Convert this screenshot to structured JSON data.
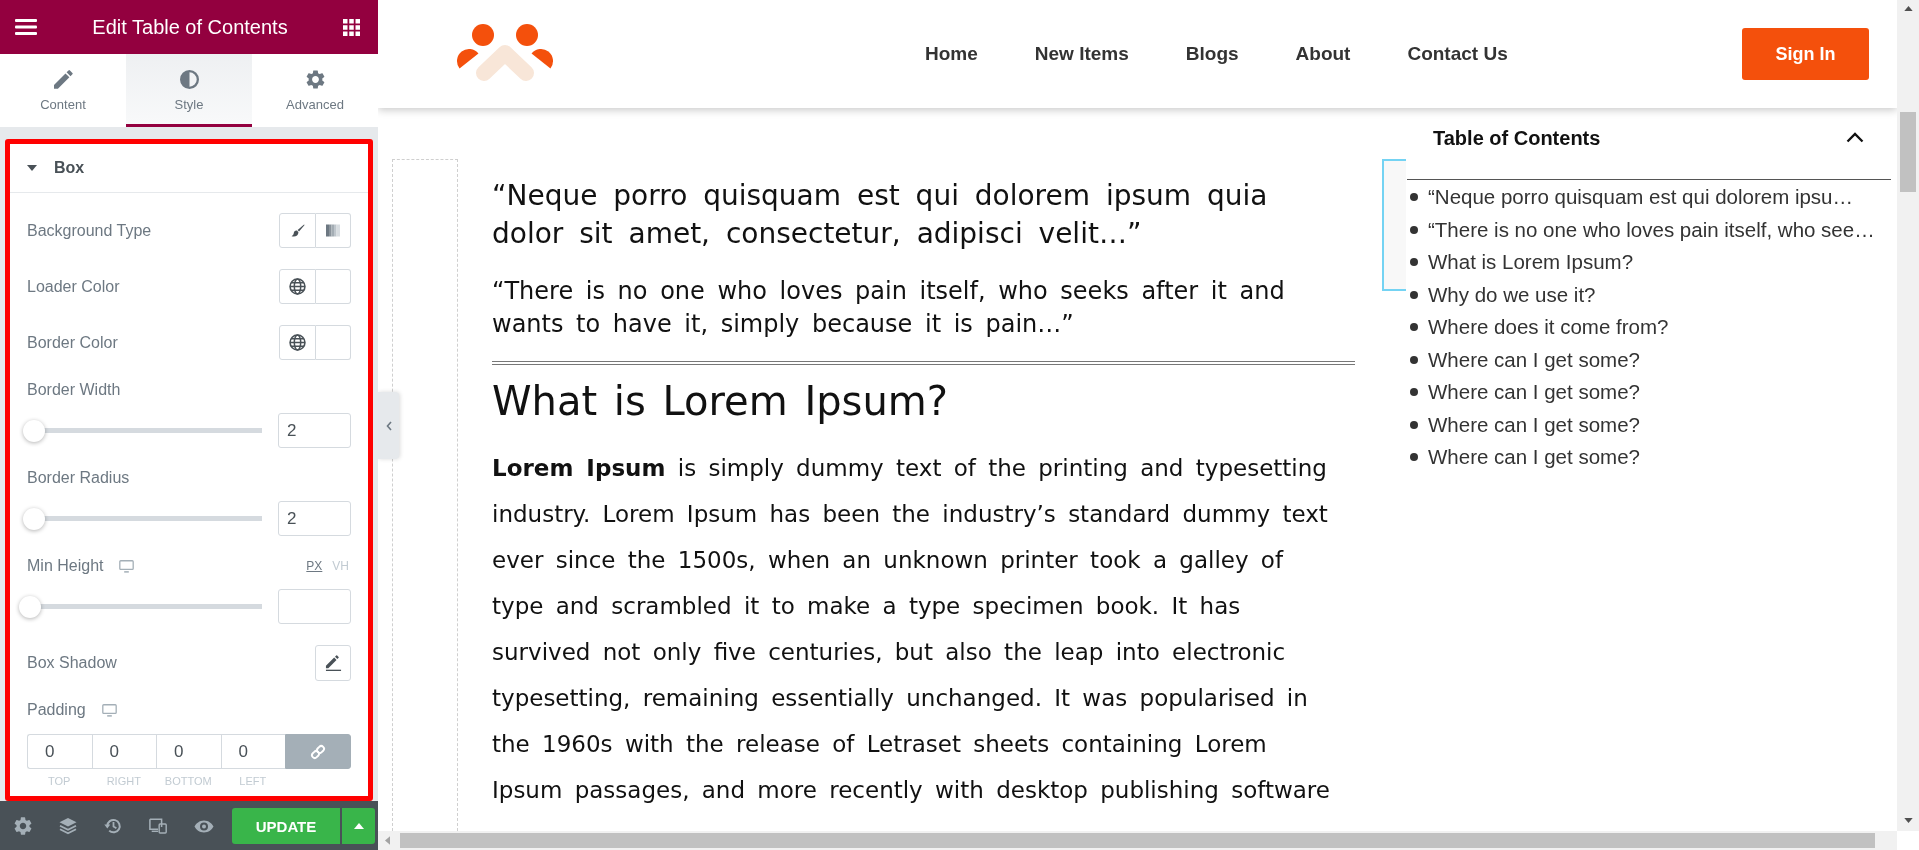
{
  "editor": {
    "title": "Edit Table of Contents",
    "tabs": [
      {
        "label": "Content",
        "selected": false
      },
      {
        "label": "Style",
        "selected": true
      },
      {
        "label": "Advanced",
        "selected": false
      }
    ],
    "section": {
      "title": "Box",
      "expanded": true,
      "controls": [
        {
          "kind": "choose",
          "label": "Background Type"
        },
        {
          "kind": "color",
          "label": "Loader Color"
        },
        {
          "kind": "color",
          "label": "Border Color"
        },
        {
          "kind": "slider",
          "label": "Border Width",
          "level": 0.02,
          "value": "2"
        },
        {
          "kind": "slider",
          "label": "Border Radius",
          "level": 0.02,
          "value": "2"
        },
        {
          "kind": "slider",
          "label": "Min Height",
          "responsive": true,
          "units": [
            {
              "label": "PX",
              "selected": true
            },
            {
              "label": "VH",
              "selected": false
            }
          ],
          "level": 0
        },
        {
          "kind": "popover",
          "label": "Box Shadow"
        },
        {
          "kind": "dimensions",
          "label": "Padding",
          "responsive": true,
          "linked": true,
          "fields": [
            {
              "value": "0",
              "label": "TOP"
            },
            {
              "value": "0",
              "label": "RIGHT"
            },
            {
              "value": "0",
              "label": "BOTTOM"
            },
            {
              "value": "0",
              "label": "LEFT"
            }
          ]
        }
      ]
    },
    "footer": {
      "update_label": "UPDATE"
    }
  },
  "site": {
    "nav": [
      {
        "label": "Home"
      },
      {
        "label": "New Items"
      },
      {
        "label": "Blogs"
      },
      {
        "label": "About"
      },
      {
        "label": "Contact Us"
      }
    ],
    "sign_in": "Sign In"
  },
  "article": {
    "quotes": [
      "“Neque porro quisquam est qui dolorem ipsum quia dolor sit amet, consectetur, adipisci velit…”",
      "“There is no one who loves pain itself, who seeks after it and wants to have it, simply because it is pain…”"
    ],
    "heading": "What is Lorem Ipsum?",
    "paragraph": "**Lorem Ipsum** is simply dummy text of the printing and typesetting industry. Lorem Ipsum has been the industry’s standard dummy text ever since the 1500s, when an unknown printer took a galley of type and scrambled it to make a type specimen book. It has survived not only five centuries, but also the leap into electronic typesetting, remaining essentially unchanged. It was popularised in the 1960s with the release of Letraset sheets containing Lorem Ipsum passages, and more recently with desktop publishing software"
  },
  "toc": {
    "title": "Table of Contents",
    "expanded": true,
    "items": [
      "“Neque porro quisquam est qui dolorem ipsu…",
      "“There is no one who loves pain itself, who see…",
      "What is Lorem Ipsum?",
      "Why do we use it?",
      "Where does it come from?",
      "Where can I get some?",
      "Where can I get some?",
      "Where can I get some?",
      "Where can I get some?"
    ]
  }
}
